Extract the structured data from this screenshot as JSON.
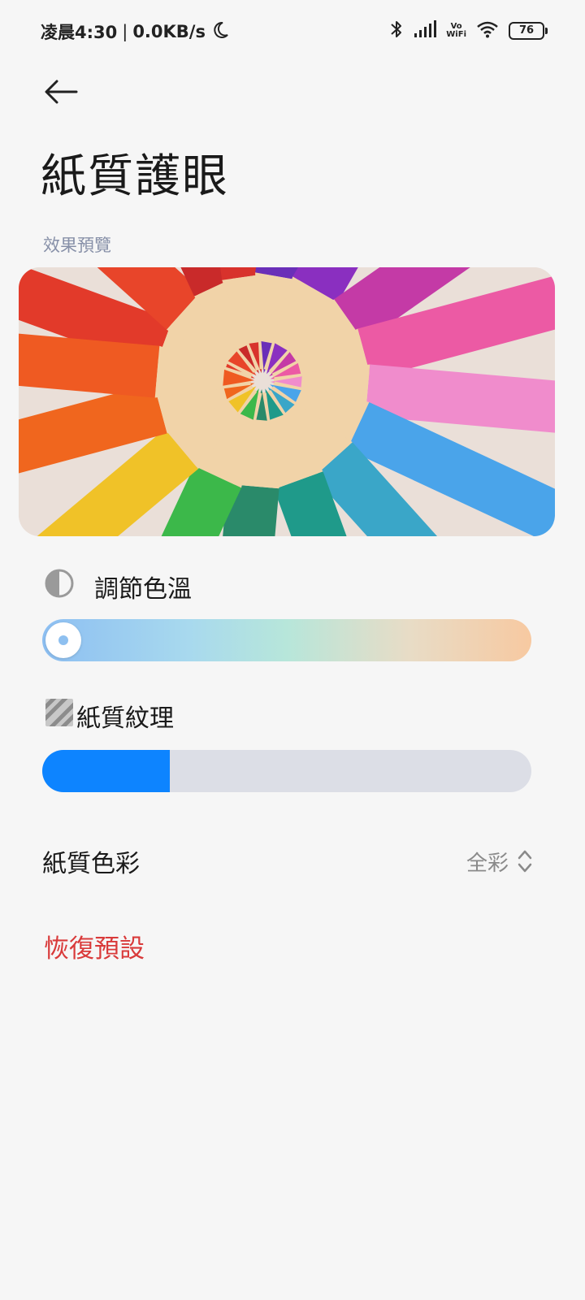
{
  "status_bar": {
    "time": "凌晨4:30",
    "network_speed": "0.0KB/s",
    "vowifi_top": "Vo",
    "vowifi_bottom": "WiFi",
    "battery": "76"
  },
  "header": {
    "title": "紙質護眼"
  },
  "preview": {
    "label": "效果預覽"
  },
  "color_temperature": {
    "label": "調節色溫",
    "level": 0.0
  },
  "paper_texture": {
    "label": "紙質紋理",
    "level": 0.26
  },
  "paper_color": {
    "label": "紙質色彩",
    "value": "全彩"
  },
  "restore": {
    "label": "恢復預設"
  },
  "colors": {
    "accent": "#0d84ff",
    "restore": "#d93a3a",
    "section_label": "#8790a8"
  }
}
